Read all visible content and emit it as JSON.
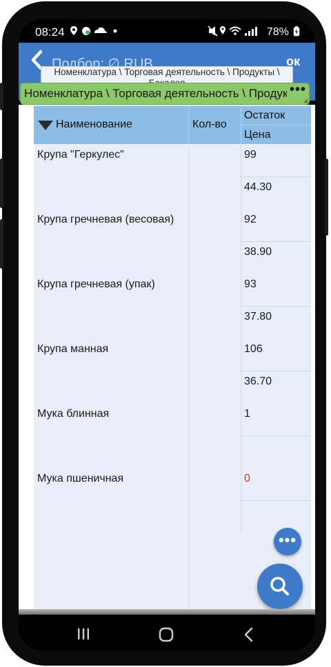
{
  "status_bar": {
    "time": "08:24",
    "left_icons": [
      "location-icon",
      "vpn-icon",
      "cloud-icon",
      "dot-icon"
    ],
    "right_icons": [
      "mute-icon",
      "location-icon",
      "wifi-icon",
      "signal-icon"
    ],
    "battery": "78%"
  },
  "app_bar": {
    "title": "Подбор: ∅ RUB,",
    "ok_label": "ок"
  },
  "tooltip": {
    "line1": "Номенклатура \\ Торговая деятельность \\ Продукты \\",
    "line2": "Бакалея"
  },
  "path_bar": {
    "text": "Номенклатура \\ Торговая деятельность \\ Продукты \\ Бакалея",
    "more_label": "•••"
  },
  "table": {
    "headers": {
      "name": "Наименование",
      "qty": "Кол-во",
      "stock": "Остаток",
      "price": "Цена"
    },
    "rows": [
      {
        "name": "Крупа \"Геркулес\"",
        "qty": "",
        "stock": "99",
        "price": "44.30"
      },
      {
        "name": "Крупа гречневая (весовая)",
        "qty": "",
        "stock": "92",
        "price": "38.90"
      },
      {
        "name": "Крупа гречневая (упак)",
        "qty": "",
        "stock": "93",
        "price": "37.80"
      },
      {
        "name": "Крупа манная",
        "qty": "",
        "stock": "106",
        "price": "36.70"
      },
      {
        "name": "Мука блинная",
        "qty": "",
        "stock": "1",
        "price": ""
      },
      {
        "name": "Мука пшеничная",
        "qty": "",
        "stock": "0",
        "price": ""
      }
    ]
  },
  "fab": {
    "more_label": "•••"
  },
  "colors": {
    "app_bar": "#3e7ac8",
    "path_bar": "#8dc868",
    "table_header": "#8dbde6",
    "row_bg": "#e8eef7",
    "negative_stock": "#e0312b"
  }
}
